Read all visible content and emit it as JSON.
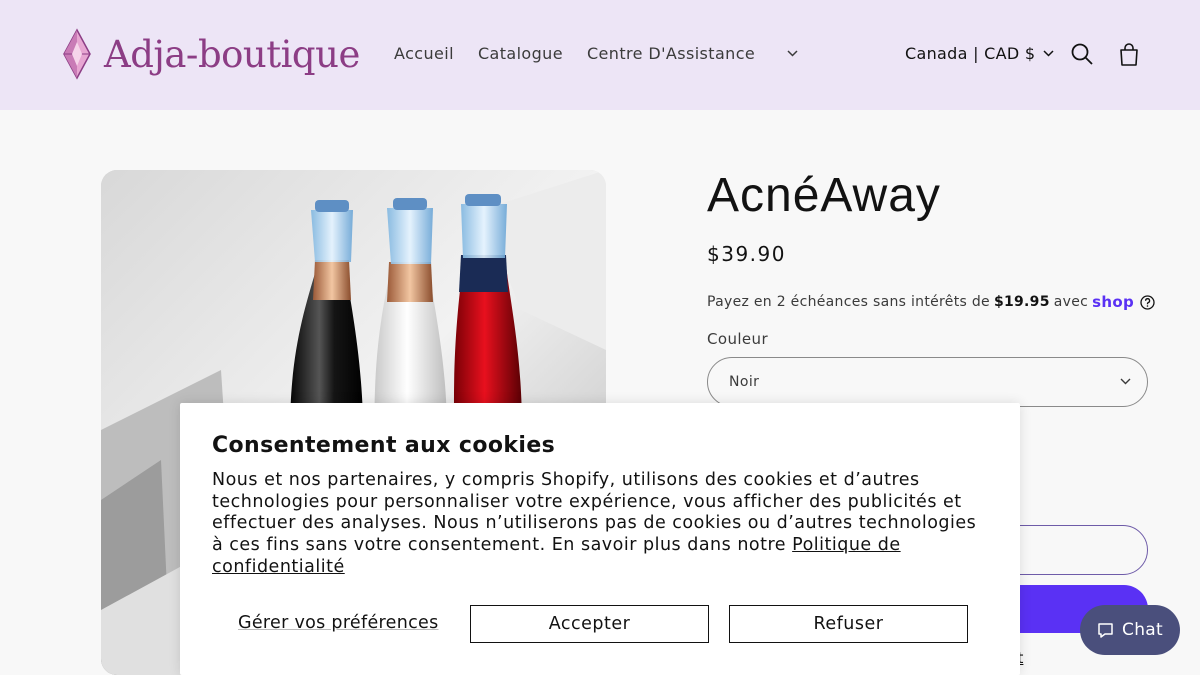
{
  "header": {
    "logo_text": "Adja-boutique",
    "nav": [
      {
        "label": "Accueil"
      },
      {
        "label": "Catalogue"
      },
      {
        "label": "Centre D'Assistance"
      }
    ],
    "locale": "Canada | CAD $",
    "colors": {
      "background": "#ede5f6",
      "logo": "#8c3d85"
    }
  },
  "product": {
    "title": "AcnéAway",
    "price": "$39.90",
    "installments": {
      "prefix": "Payez en 2 échéances sans intérêts de",
      "amount": "$19.95",
      "suffix": "avec",
      "brand": "shop"
    },
    "color_label": "Couleur",
    "color_selected": "Noir",
    "more_link_partial": "nt"
  },
  "cookie": {
    "title": "Consentement aux cookies",
    "body": "Nous et nos partenaires, y compris Shopify, utilisons des cookies et d’autres technologies pour personnaliser votre expérience, vous afficher des publicités et effectuer des analyses. Nous n’utiliserons pas de cookies ou d’autres technologies à ces fins sans votre consentement. En savoir plus dans notre",
    "policy_link": "Politique de confidentialité",
    "preferences": "Gérer vos préférences",
    "accept": "Accepter",
    "refuse": "Refuser"
  },
  "chat": {
    "label": "Chat"
  },
  "icons": [
    "gem-logo-icon",
    "chevron-down-icon",
    "search-icon",
    "cart-icon",
    "question-icon",
    "chat-bubble-icon"
  ]
}
